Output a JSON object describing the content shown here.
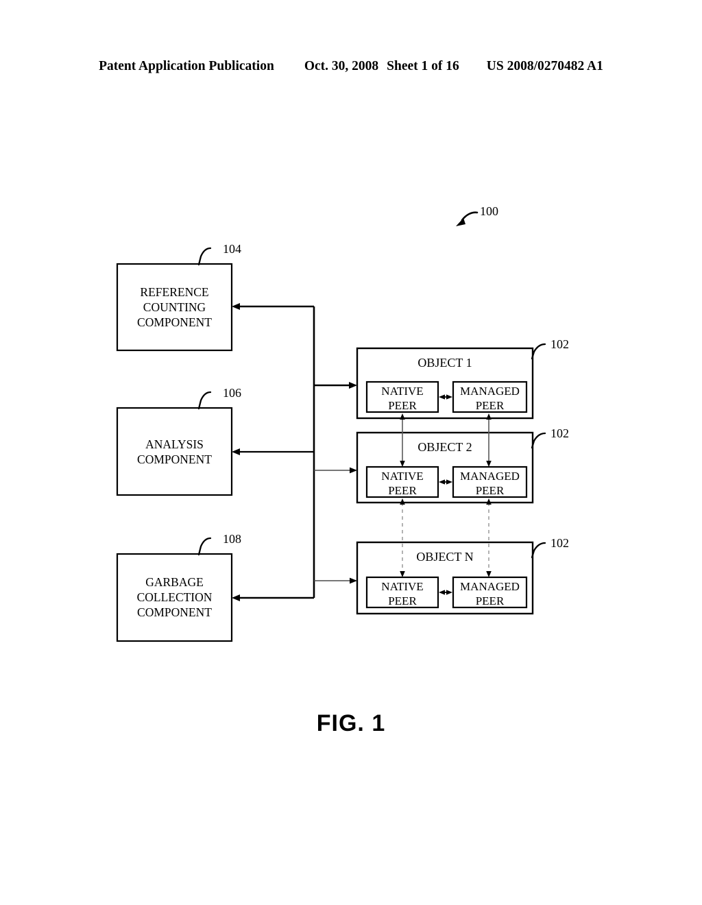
{
  "header": {
    "publication": "Patent Application Publication",
    "date": "Oct. 30, 2008",
    "sheet": "Sheet 1 of 16",
    "patent_number": "US 2008/0270482 A1"
  },
  "figure": {
    "caption": "FIG. 1",
    "system_ref": "100",
    "components": [
      {
        "ref": "104",
        "label": "REFERENCE\nCOUNTING\nCOMPONENT"
      },
      {
        "ref": "106",
        "label": "ANALYSIS\nCOMPONENT"
      },
      {
        "ref": "108",
        "label": "GARBAGE\nCOLLECTION\nCOMPONENT"
      }
    ],
    "objects": [
      {
        "ref": "102",
        "title": "OBJECT 1",
        "native_peer": "NATIVE\nPEER",
        "managed_peer": "MANAGED\nPEER"
      },
      {
        "ref": "102",
        "title": "OBJECT 2",
        "native_peer": "NATIVE\nPEER",
        "managed_peer": "MANAGED\nPEER"
      },
      {
        "ref": "102",
        "title": "OBJECT N",
        "native_peer": "NATIVE\nPEER",
        "managed_peer": "MANAGED\nPEER"
      }
    ]
  },
  "colors": {
    "ink": "#000000",
    "paper": "#ffffff",
    "thin_line": "#555555",
    "dashed_line": "#999999"
  }
}
